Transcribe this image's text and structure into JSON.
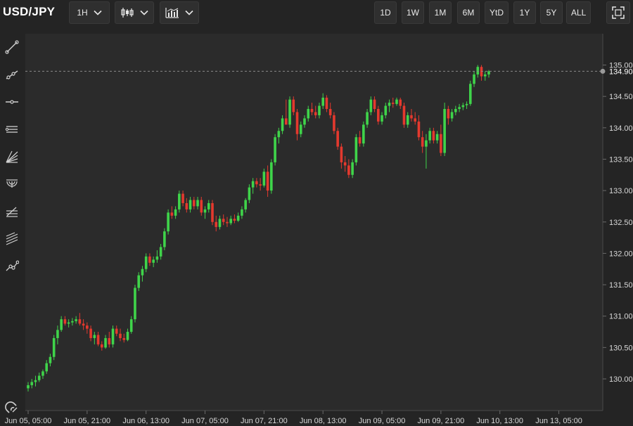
{
  "header": {
    "symbol": "USD/JPY",
    "interval_label": "1H",
    "icons": {
      "interval_dropdown": "chevron-down-icon",
      "chart_type": "candlestick-icon",
      "indicators": "indicators-chart-icon",
      "fullscreen": "fullscreen-icon"
    },
    "ranges": [
      "1D",
      "1W",
      "1M",
      "6M",
      "YtD",
      "1Y",
      "5Y",
      "ALL"
    ]
  },
  "sidebar": {
    "tools": [
      {
        "icon": "trend-line-icon"
      },
      {
        "icon": "ray-line-icon"
      },
      {
        "icon": "horizontal-line-icon"
      },
      {
        "icon": "parallel-channel-icon"
      },
      {
        "icon": "fibonacci-fan-icon"
      },
      {
        "icon": "fibonacci-arc-icon"
      },
      {
        "icon": "fibonacci-retracement-icon"
      },
      {
        "icon": "pitchfork-icon"
      },
      {
        "icon": "path-tool-icon"
      }
    ],
    "bottom_tool": {
      "icon": "magnet-icon"
    }
  },
  "colors": {
    "background": "#242424",
    "plot": "#2b2b2b",
    "up": "#3fd44a",
    "down": "#e4392e",
    "axis_text": "#d8d8d8",
    "price_line": "#8a8a8a"
  },
  "chart_data": {
    "type": "candlestick",
    "title": "",
    "xlabel": "",
    "ylabel": "",
    "ylim": [
      129.57,
      135.52
    ],
    "y_ticks": [
      130.0,
      130.5,
      131.0,
      131.5,
      132.0,
      132.5,
      133.0,
      133.5,
      134.0,
      134.5,
      135.0
    ],
    "y_tick_labels": [
      "130.00",
      "130.50",
      "131.00",
      "131.50",
      "132.00",
      "132.50",
      "133.00",
      "133.50",
      "134.00",
      "134.50",
      "135.00"
    ],
    "x_ticks": [
      {
        "label": "Jun 05, 05:00",
        "index": 0
      },
      {
        "label": "Jun 05, 21:00",
        "index": 16
      },
      {
        "label": "Jun 06, 13:00",
        "index": 32
      },
      {
        "label": "Jun 07, 05:00",
        "index": 48
      },
      {
        "label": "Jun 07, 21:00",
        "index": 64
      },
      {
        "label": "Jun 08, 13:00",
        "index": 80
      },
      {
        "label": "Jun 09, 05:00",
        "index": 96
      },
      {
        "label": "Jun 09, 21:00",
        "index": 112
      },
      {
        "label": "Jun 10, 13:00",
        "index": 128
      },
      {
        "label": "Jun 13, 05:00",
        "index": 144
      }
    ],
    "last_price": 134.9,
    "last_price_label": "134.90",
    "grid": false,
    "candles": [
      [
        129.85,
        129.95,
        129.8,
        129.9
      ],
      [
        129.9,
        130.0,
        129.85,
        129.95
      ],
      [
        129.95,
        130.05,
        129.88,
        129.98
      ],
      [
        129.98,
        130.1,
        129.95,
        130.05
      ],
      [
        130.05,
        130.15,
        130.0,
        130.12
      ],
      [
        130.12,
        130.3,
        130.08,
        130.25
      ],
      [
        130.25,
        130.4,
        130.2,
        130.35
      ],
      [
        130.35,
        130.7,
        130.3,
        130.65
      ],
      [
        130.65,
        130.85,
        130.55,
        130.78
      ],
      [
        130.78,
        131.0,
        130.75,
        130.95
      ],
      [
        130.95,
        131.0,
        130.85,
        130.88
      ],
      [
        130.88,
        130.95,
        130.82,
        130.9
      ],
      [
        130.9,
        130.97,
        130.85,
        130.92
      ],
      [
        130.92,
        131.0,
        130.88,
        130.95
      ],
      [
        130.95,
        131.05,
        130.85,
        130.88
      ],
      [
        130.88,
        130.95,
        130.78,
        130.85
      ],
      [
        130.85,
        130.9,
        130.72,
        130.8
      ],
      [
        130.8,
        130.85,
        130.6,
        130.65
      ],
      [
        130.65,
        130.75,
        130.55,
        130.7
      ],
      [
        130.7,
        130.75,
        130.52,
        130.55
      ],
      [
        130.55,
        130.6,
        130.45,
        130.5
      ],
      [
        130.5,
        130.7,
        130.48,
        130.65
      ],
      [
        130.65,
        130.75,
        130.5,
        130.55
      ],
      [
        130.55,
        130.85,
        130.5,
        130.8
      ],
      [
        130.8,
        130.85,
        130.68,
        130.72
      ],
      [
        130.72,
        130.8,
        130.6,
        130.65
      ],
      [
        130.65,
        130.72,
        130.58,
        130.62
      ],
      [
        130.62,
        130.8,
        130.6,
        130.75
      ],
      [
        130.75,
        131.0,
        130.72,
        130.95
      ],
      [
        130.95,
        131.5,
        130.9,
        131.45
      ],
      [
        131.45,
        131.7,
        131.4,
        131.65
      ],
      [
        131.65,
        131.8,
        131.55,
        131.75
      ],
      [
        131.75,
        132.0,
        131.7,
        131.95
      ],
      [
        131.95,
        132.0,
        131.8,
        131.85
      ],
      [
        131.85,
        131.95,
        131.78,
        131.9
      ],
      [
        131.9,
        132.05,
        131.85,
        131.95
      ],
      [
        131.95,
        132.15,
        131.9,
        132.1
      ],
      [
        132.1,
        132.4,
        132.05,
        132.35
      ],
      [
        132.35,
        132.7,
        132.3,
        132.65
      ],
      [
        132.65,
        132.75,
        132.55,
        132.6
      ],
      [
        132.6,
        132.75,
        132.55,
        132.7
      ],
      [
        132.7,
        133.0,
        132.65,
        132.95
      ],
      [
        132.95,
        133.0,
        132.75,
        132.8
      ],
      [
        132.8,
        132.88,
        132.65,
        132.7
      ],
      [
        132.7,
        132.9,
        132.65,
        132.85
      ],
      [
        132.85,
        132.9,
        132.7,
        132.75
      ],
      [
        132.75,
        132.9,
        132.7,
        132.85
      ],
      [
        132.85,
        132.9,
        132.6,
        132.65
      ],
      [
        132.65,
        132.75,
        132.55,
        132.7
      ],
      [
        132.7,
        132.85,
        132.65,
        132.8
      ],
      [
        132.8,
        132.85,
        132.45,
        132.5
      ],
      [
        132.5,
        132.6,
        132.35,
        132.42
      ],
      [
        132.42,
        132.6,
        132.38,
        132.55
      ],
      [
        132.55,
        132.62,
        132.45,
        132.5
      ],
      [
        132.5,
        132.58,
        132.42,
        132.48
      ],
      [
        132.48,
        132.6,
        132.45,
        132.55
      ],
      [
        132.55,
        132.62,
        132.48,
        132.52
      ],
      [
        132.52,
        132.65,
        132.5,
        132.6
      ],
      [
        132.6,
        132.75,
        132.55,
        132.7
      ],
      [
        132.7,
        132.88,
        132.65,
        132.85
      ],
      [
        132.85,
        133.1,
        132.8,
        133.05
      ],
      [
        133.05,
        133.2,
        132.95,
        133.15
      ],
      [
        133.15,
        133.2,
        133.05,
        133.1
      ],
      [
        133.1,
        133.2,
        133.0,
        133.08
      ],
      [
        133.08,
        133.35,
        133.05,
        133.3
      ],
      [
        133.3,
        133.4,
        132.9,
        133.0
      ],
      [
        133.0,
        133.5,
        132.95,
        133.45
      ],
      [
        133.45,
        133.9,
        133.4,
        133.85
      ],
      [
        133.85,
        134.0,
        133.75,
        133.95
      ],
      [
        133.95,
        134.2,
        133.9,
        134.15
      ],
      [
        134.15,
        134.45,
        134.1,
        134.05
      ],
      [
        134.05,
        134.5,
        134.0,
        134.45
      ],
      [
        134.45,
        134.5,
        134.2,
        134.25
      ],
      [
        134.25,
        134.3,
        133.8,
        133.9
      ],
      [
        133.9,
        134.1,
        133.85,
        134.05
      ],
      [
        134.05,
        134.2,
        134.0,
        134.15
      ],
      [
        134.15,
        134.35,
        134.1,
        134.3
      ],
      [
        134.3,
        134.4,
        134.2,
        134.25
      ],
      [
        134.25,
        134.35,
        134.15,
        134.2
      ],
      [
        134.2,
        134.4,
        134.15,
        134.35
      ],
      [
        134.35,
        134.55,
        134.3,
        134.48
      ],
      [
        134.48,
        134.52,
        134.25,
        134.3
      ],
      [
        134.3,
        134.4,
        134.15,
        134.2
      ],
      [
        134.2,
        134.25,
        133.9,
        133.95
      ],
      [
        133.95,
        134.0,
        133.65,
        133.7
      ],
      [
        133.7,
        133.75,
        133.35,
        133.45
      ],
      [
        133.45,
        133.55,
        133.3,
        133.4
      ],
      [
        133.4,
        133.5,
        133.2,
        133.25
      ],
      [
        133.25,
        133.5,
        133.2,
        133.45
      ],
      [
        133.45,
        133.9,
        133.4,
        133.85
      ],
      [
        133.85,
        133.95,
        133.7,
        133.75
      ],
      [
        133.75,
        134.1,
        133.7,
        134.05
      ],
      [
        134.05,
        134.3,
        134.0,
        134.25
      ],
      [
        134.25,
        134.5,
        134.2,
        134.45
      ],
      [
        134.45,
        134.5,
        134.25,
        134.3
      ],
      [
        134.3,
        134.35,
        134.05,
        134.1
      ],
      [
        134.1,
        134.25,
        134.05,
        134.2
      ],
      [
        134.2,
        134.4,
        134.15,
        134.35
      ],
      [
        134.35,
        134.45,
        134.25,
        134.4
      ],
      [
        134.4,
        134.48,
        134.32,
        134.38
      ],
      [
        134.38,
        134.48,
        134.35,
        134.45
      ],
      [
        134.45,
        134.48,
        134.3,
        134.35
      ],
      [
        134.35,
        134.4,
        134.0,
        134.05
      ],
      [
        134.05,
        134.25,
        134.0,
        134.2
      ],
      [
        134.2,
        134.3,
        134.1,
        134.15
      ],
      [
        134.15,
        134.25,
        134.05,
        134.1
      ],
      [
        134.1,
        134.2,
        133.8,
        133.85
      ],
      [
        133.85,
        133.95,
        133.6,
        133.7
      ],
      [
        133.7,
        133.9,
        133.35,
        133.8
      ],
      [
        133.8,
        134.0,
        133.75,
        133.95
      ],
      [
        133.95,
        134.0,
        133.75,
        133.8
      ],
      [
        133.8,
        133.95,
        133.75,
        133.9
      ],
      [
        133.9,
        134.05,
        133.55,
        133.6
      ],
      [
        133.6,
        134.4,
        133.55,
        134.3
      ],
      [
        134.3,
        134.35,
        134.05,
        134.15
      ],
      [
        134.15,
        134.3,
        134.1,
        134.25
      ],
      [
        134.25,
        134.35,
        134.2,
        134.3
      ],
      [
        134.3,
        134.38,
        134.25,
        134.33
      ],
      [
        134.33,
        134.4,
        134.28,
        134.36
      ],
      [
        134.36,
        134.42,
        134.3,
        134.38
      ],
      [
        134.38,
        134.75,
        134.35,
        134.7
      ],
      [
        134.7,
        134.9,
        134.65,
        134.85
      ],
      [
        134.85,
        135.0,
        134.8,
        134.97
      ],
      [
        134.97,
        135.0,
        134.75,
        134.82
      ],
      [
        134.82,
        134.9,
        134.75,
        134.85
      ],
      [
        134.85,
        134.92,
        134.8,
        134.9
      ]
    ]
  }
}
